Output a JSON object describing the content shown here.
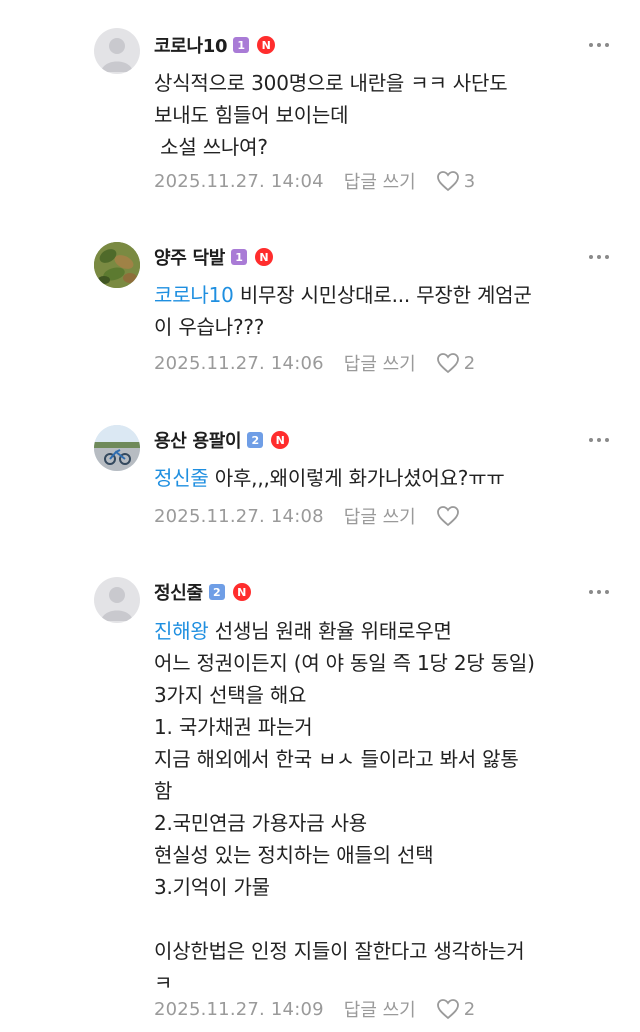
{
  "comments": [
    {
      "nickname": "코로나10",
      "level": "1",
      "level_color": "#a97bd6",
      "badge": "N",
      "mention": "",
      "first_line": "상식적으로 300명으로 내란을 ㅋㅋ 사단도",
      "lines": [
        "보내도 힘들어 보이는데",
        " 소설 쓰나여?"
      ],
      "date": "2025.11.27. 14:04",
      "reply_label": "답글 쓰기",
      "likes": "3"
    },
    {
      "nickname": "양주 닥발",
      "level": "1",
      "level_color": "#a97bd6",
      "badge": "N",
      "mention": "코로나10",
      "first_line": " 비무장 시민상대로... 무장한 계엄군",
      "lines": [
        "이 우습나???"
      ],
      "date": "2025.11.27. 14:06",
      "reply_label": "답글 쓰기",
      "likes": "2"
    },
    {
      "nickname": "용산 용팔이",
      "level": "2",
      "level_color": "#6f9ee6",
      "badge": "N",
      "mention": "정신줄",
      "first_line": " 아후,,,왜이렇게 화가나셨어요?ㅠㅠ",
      "lines": [],
      "date": "2025.11.27. 14:08",
      "reply_label": "답글 쓰기",
      "likes": ""
    },
    {
      "nickname": "정신줄",
      "level": "2",
      "level_color": "#6f9ee6",
      "badge": "N",
      "mention": "진해왕",
      "first_line": " 선생님 원래 환율 위태로우면",
      "lines": [
        "어느 정권이든지 (여 야 동일 즉 1당 2당 동일)",
        "3가지 선택을 해요",
        "1. 국가채권 파는거",
        "지금 해외에서 한국 ㅂㅅ 들이라고 봐서 앓통",
        "함",
        "2.국민연금 가용자금 사용",
        "현실성 있는 정치하는 애들의 선택",
        "3.기억이 가물",
        "",
        "이상한법은 인정 지들이 잘한다고 생각하는거",
        "ㅋ"
      ],
      "date": "2025.11.27. 14:09",
      "reply_label": "답글 쓰기",
      "likes": "2"
    }
  ]
}
